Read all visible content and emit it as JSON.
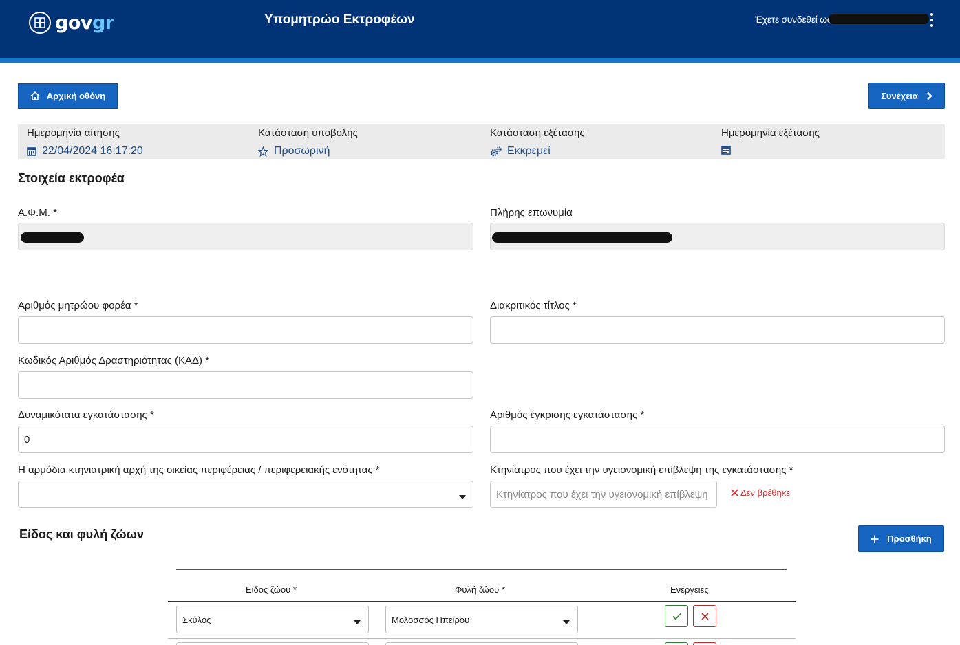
{
  "header": {
    "logo_main": "gov",
    "logo_accent": "gr",
    "title": "Υπομητρώο Εκτροφέων",
    "user_label": "Έχετε συνδεθεί ως"
  },
  "toolbar": {
    "home_label": "Αρχική οθόνη",
    "continue_label": "Συνέχεια"
  },
  "status": {
    "application_date_label": "Ημερομηνία αίτησης",
    "application_date_value": "22/04/2024 16:17:20",
    "submission_status_label": "Κατάσταση υποβολής",
    "submission_status_value": "Προσωρινή",
    "review_status_label": "Κατάσταση εξέτασης",
    "review_status_value": "Εκκρεμεί",
    "review_date_label": "Ημερομηνία εξέτασης",
    "review_date_value": ""
  },
  "breeder": {
    "section_title": "Στοιχεία εκτροφέα",
    "afm_label": "Α.Φ.Μ. *",
    "full_name_label": "Πλήρης επωνυμία",
    "registry_number_label": "Αριθμός μητρώου φορέα *",
    "registry_number_value": "",
    "distinctive_title_label": "Διακριτικός τίτλος *",
    "distinctive_title_value": "",
    "kad_label": "Κωδικός Αριθμός Δραστηριότητας (ΚΑΔ) *",
    "kad_value": "",
    "capacity_label": "Δυναμικότατα εγκατάστασης *",
    "capacity_value": "0",
    "approval_number_label": "Αριθμός έγκρισης εγκατάστασης *",
    "approval_number_value": "",
    "vet_authority_label": "Η αρμόδια κτηνιατρική αρχή της οικείας περιφέρειας / περιφερειακής ενότητας *",
    "vet_authority_value": "",
    "vet_label": "Κτηνίατρος που έχει την υγειονομική επίβλεψη της εγκατάστασης *",
    "vet_placeholder": "Κτηνίατρος που έχει την υγειονομική επίβλεψη",
    "vet_not_found": "Δεν βρέθηκε"
  },
  "animals": {
    "section_title": "Είδος και φυλή ζώων",
    "add_label": "Προσθήκη",
    "columns": [
      "Είδος ζώου *",
      "Φυλή ζώου *",
      "Ενέργειες"
    ],
    "rows": [
      {
        "species": "Σκύλος",
        "breed": "Μολοσσός Ηπείρου"
      }
    ]
  },
  "colors": {
    "header_bg": "#003476",
    "accent_stripe": "#1a74c9",
    "primary_button": "#1565c0",
    "status_value": "#1f4e8c",
    "error": "#d32f2f"
  },
  "icons": [
    "home-icon",
    "chevron-right-icon",
    "calendar-icon",
    "star-outline-icon",
    "gears-icon",
    "caret-down-icon",
    "close-icon",
    "plus-icon",
    "check-icon"
  ]
}
